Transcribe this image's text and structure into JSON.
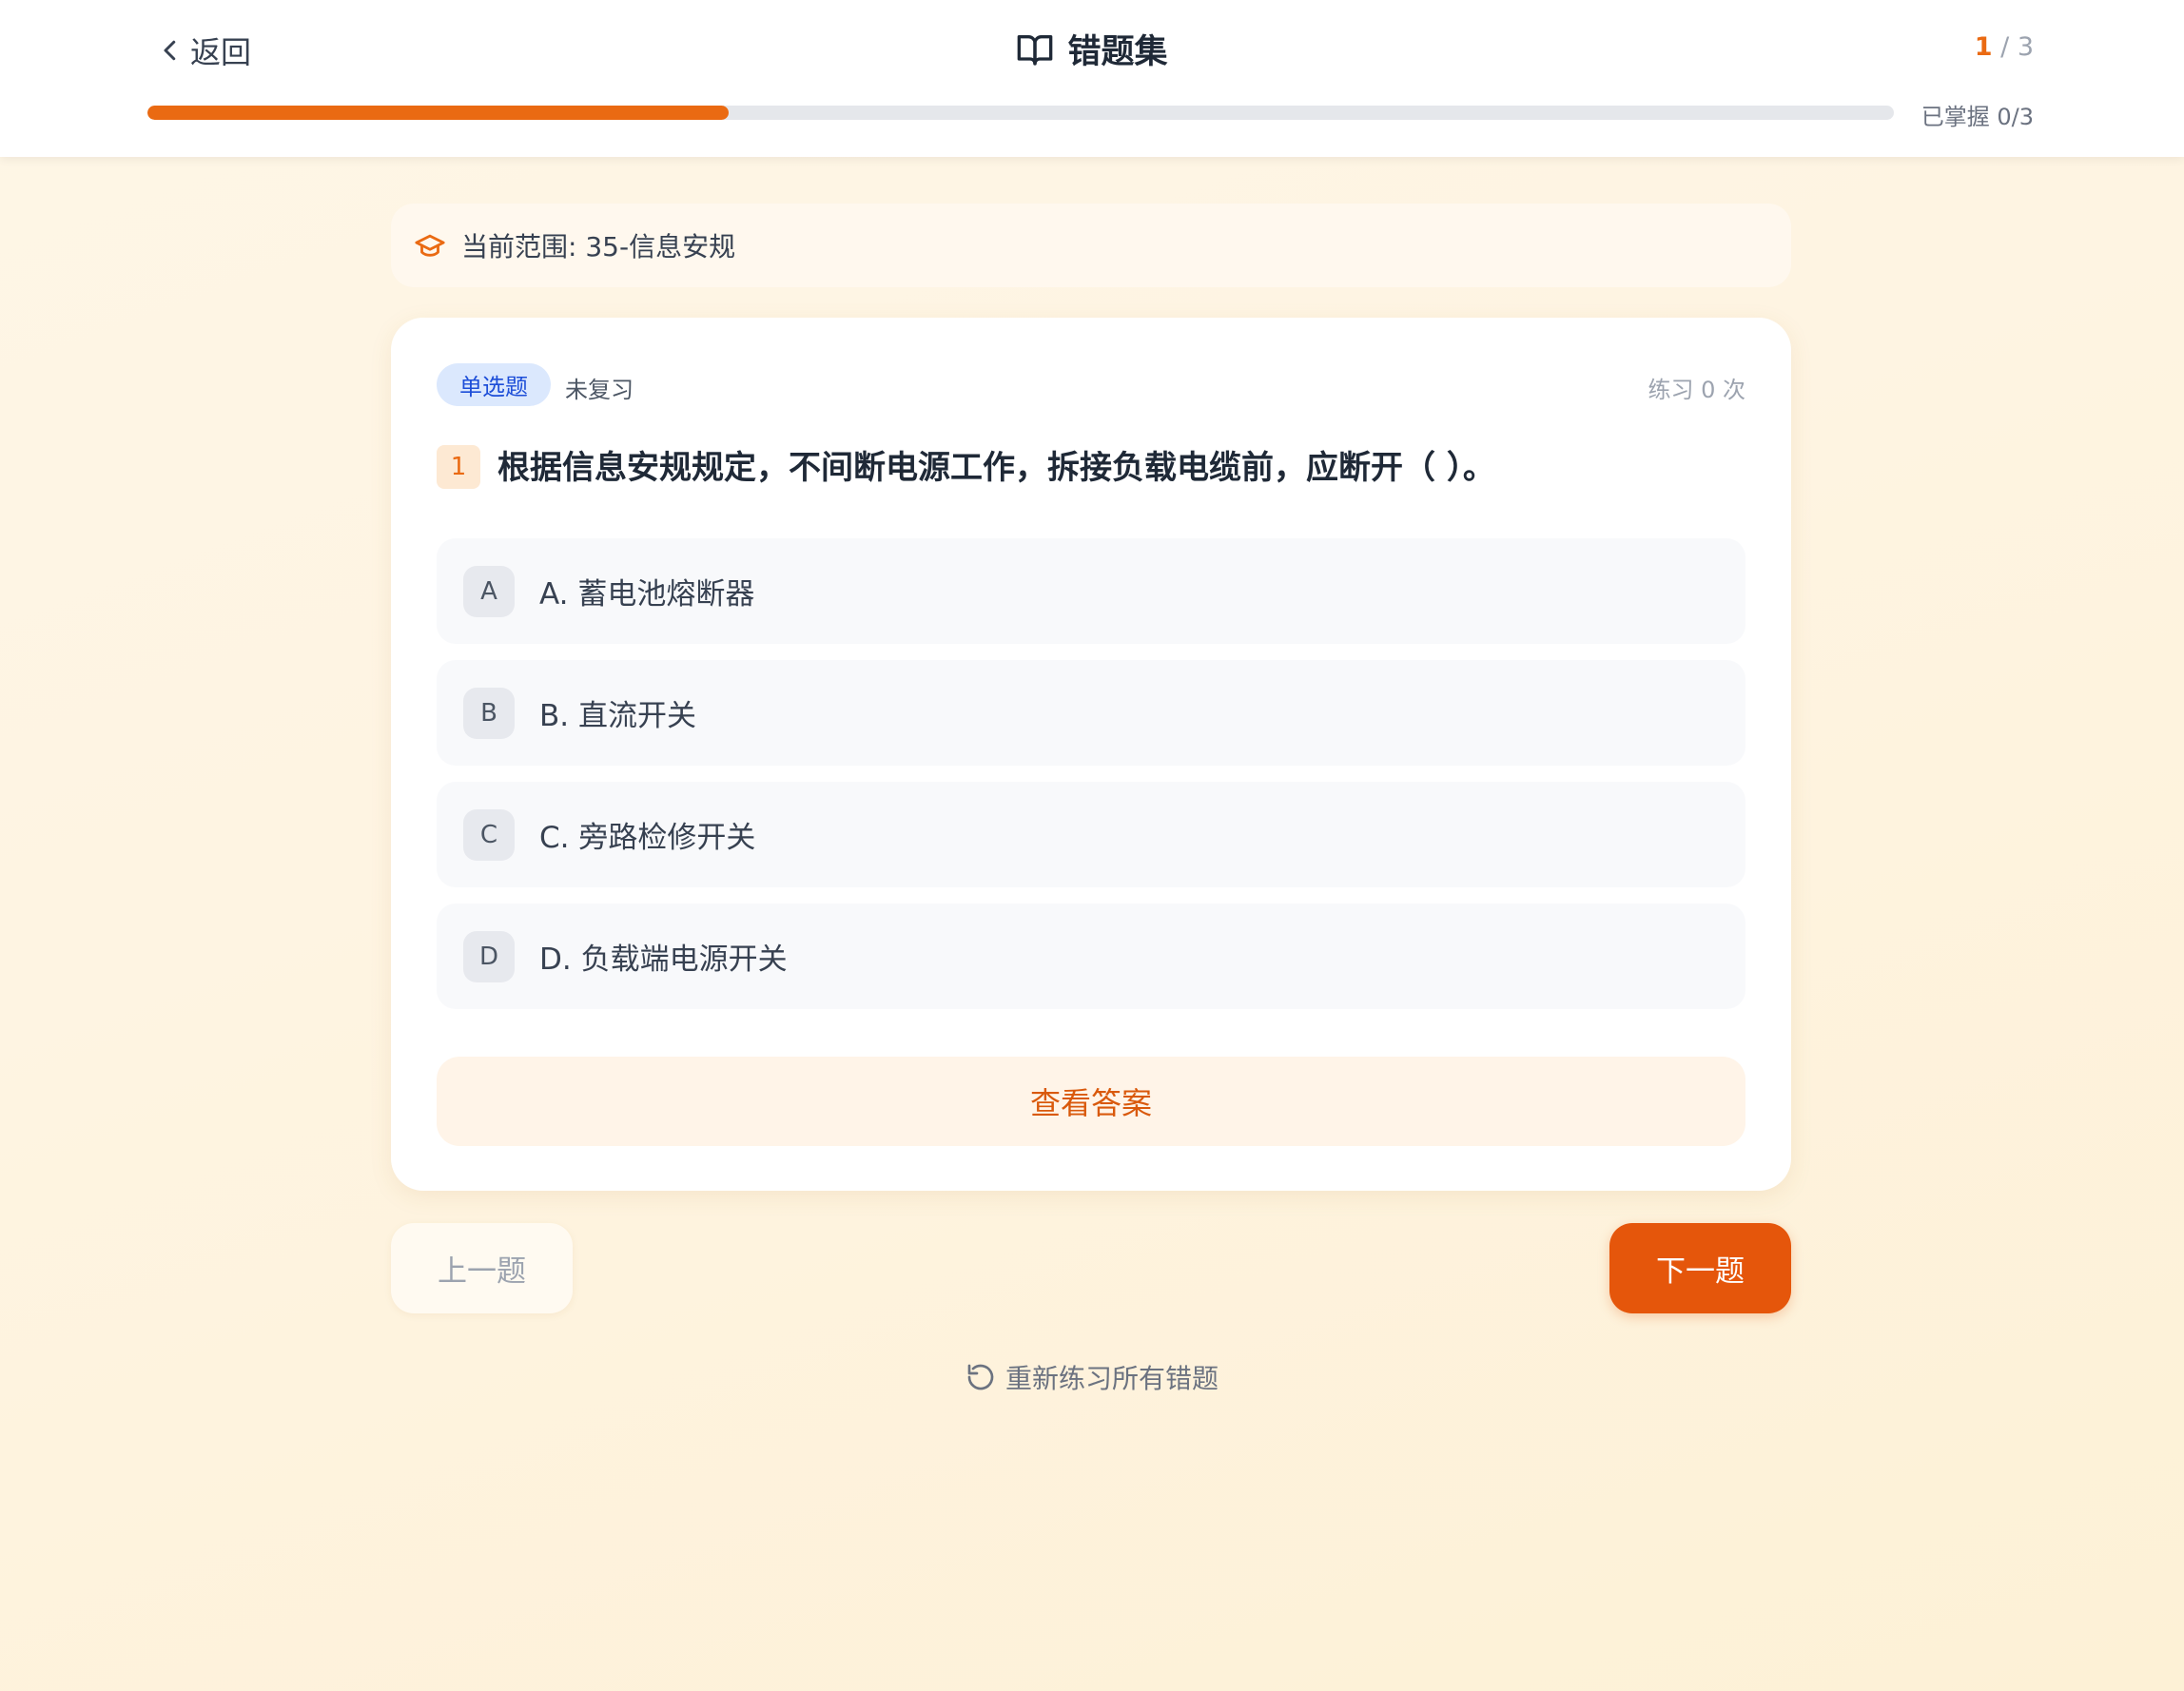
{
  "header": {
    "back_label": "返回",
    "title": "错题集",
    "counter_current": "1",
    "counter_total": "/ 3",
    "progress_fraction": 0.333,
    "mastered_label": "已掌握 0/3"
  },
  "scope": {
    "label": "当前范围: 35-信息安规"
  },
  "question": {
    "type_tag": "单选题",
    "status_tag": "未复习",
    "practice_count": "练习 0 次",
    "number": "1",
    "text": "根据信息安规规定，不间断电源工作，拆接负载电缆前，应断开（ ）。",
    "options": [
      {
        "letter": "A",
        "text": "A. 蓄电池熔断器"
      },
      {
        "letter": "B",
        "text": "B. 直流开关"
      },
      {
        "letter": "C",
        "text": "C. 旁路检修开关"
      },
      {
        "letter": "D",
        "text": "D. 负载端电源开关"
      }
    ],
    "show_answer_label": "查看答案"
  },
  "nav": {
    "prev_label": "上一题",
    "next_label": "下一题",
    "restart_label": "重新练习所有错题"
  },
  "colors": {
    "accent": "#ea6a12",
    "next_button": "#e5560b",
    "tag_blue": "#1d4ed8"
  },
  "icons": {
    "back": "chevron-left-icon",
    "title": "open-book-icon",
    "scope": "graduation-cap-icon",
    "restart": "rotate-ccw-icon"
  }
}
